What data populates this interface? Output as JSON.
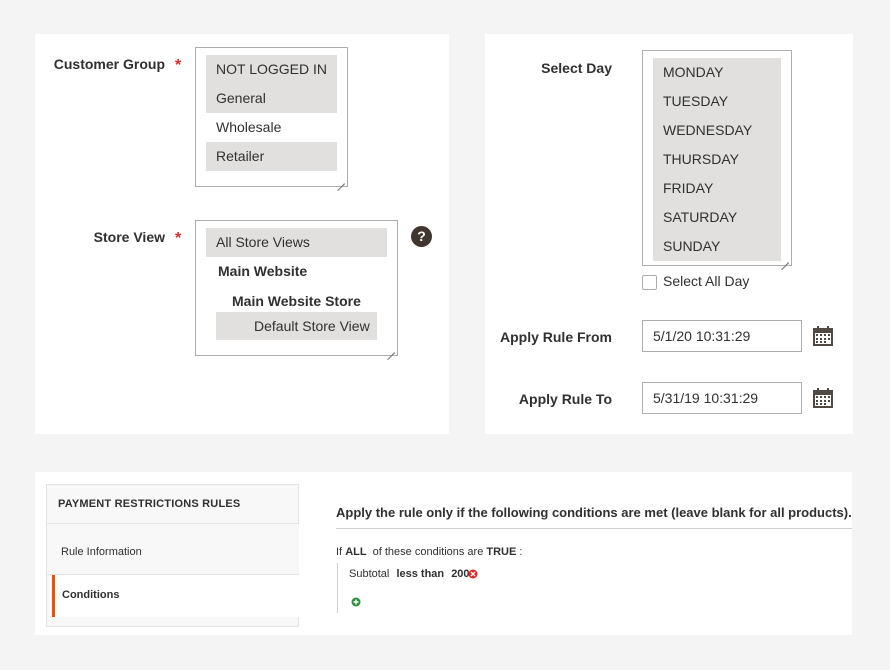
{
  "customer_group": {
    "label": "Customer Group",
    "required_mark": "*",
    "options": [
      {
        "label": "NOT LOGGED IN",
        "selected": true
      },
      {
        "label": "General",
        "selected": true
      },
      {
        "label": "Wholesale",
        "selected": false
      },
      {
        "label": "Retailer",
        "selected": true
      }
    ]
  },
  "store_view": {
    "label": "Store View",
    "required_mark": "*",
    "help_icon": "?",
    "options": [
      {
        "label": "All Store Views",
        "selected": true
      },
      {
        "label": "Main Website",
        "group": true
      },
      {
        "label": "Main Website Store",
        "group": true
      },
      {
        "label": "Default Store View",
        "selected": true
      }
    ]
  },
  "select_day": {
    "label": "Select Day",
    "options": [
      "MONDAY",
      "TUESDAY",
      "WEDNESDAY",
      "THURSDAY",
      "FRIDAY",
      "SATURDAY",
      "SUNDAY"
    ],
    "select_all_label": "Select All Day"
  },
  "apply_rule_from": {
    "label": "Apply Rule From",
    "value": "5/1/20 10:31:29"
  },
  "apply_rule_to": {
    "label": "Apply Rule To",
    "value": "5/31/19 10:31:29"
  },
  "tabs": {
    "title": "PAYMENT RESTRICTIONS RULES",
    "items": [
      {
        "label": "Rule Information",
        "active": false
      },
      {
        "label": "Conditions",
        "active": true
      }
    ]
  },
  "conditions": {
    "heading": "Apply the rule only if the following conditions are met (leave blank for all products).",
    "if_word": "If",
    "aggregator": "ALL",
    "middle_text": "of these conditions are",
    "value": "TRUE",
    "colon": ":",
    "rule": {
      "attribute": "Subtotal",
      "operator": "less than",
      "value": "200"
    }
  },
  "colors": {
    "accent": "#eb5202",
    "required": "#e22626",
    "selected_bg": "#e1e0de"
  }
}
